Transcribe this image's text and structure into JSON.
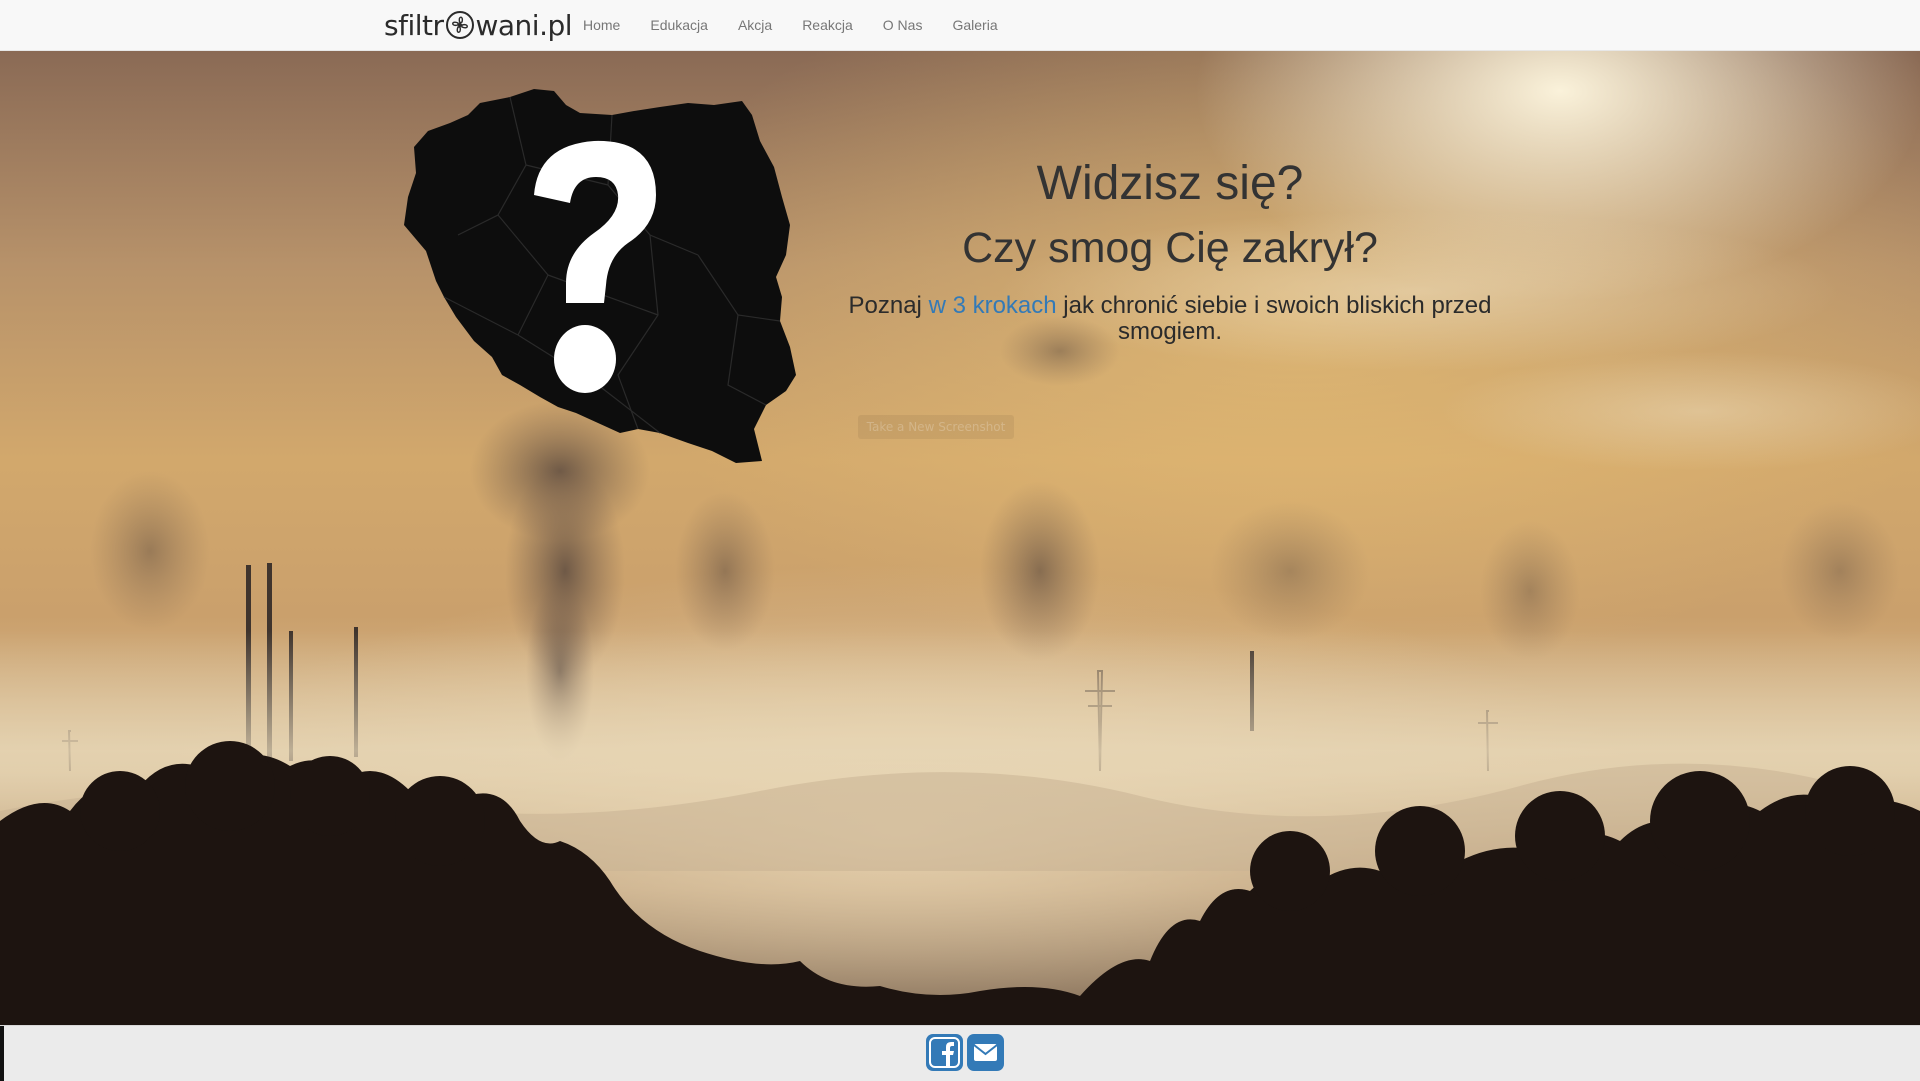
{
  "navbar": {
    "brand_left": "sfiltr",
    "brand_right": "wani.pl",
    "brand_icon": "fan-icon",
    "items": [
      {
        "label": "Home"
      },
      {
        "label": "Edukacja"
      },
      {
        "label": "Akcja"
      },
      {
        "label": "Reakcja"
      },
      {
        "label": "O Nas"
      },
      {
        "label": "Galeria"
      }
    ]
  },
  "hero": {
    "title": "Widzisz się?",
    "subtitle": "Czy smog Cię zakrył?",
    "description_prefix": "Poznaj ",
    "description_link": "w 3 krokach",
    "description_suffix": " jak chronić siebie i swoich bliskich przed smogiem.",
    "ghost_button": "Take a New Screenshot",
    "map_icon": "poland-question-mark-icon"
  },
  "footer": {
    "icons": [
      {
        "name": "facebook-icon",
        "color": "#337ab7"
      },
      {
        "name": "envelope-icon",
        "color": "#337ab7"
      }
    ]
  },
  "colors": {
    "navbar_bg": "#f8f8f8",
    "nav_link": "#777777",
    "link_accent": "#337ab7",
    "text_dark": "#333333",
    "footer_bg": "#ebebeb"
  }
}
